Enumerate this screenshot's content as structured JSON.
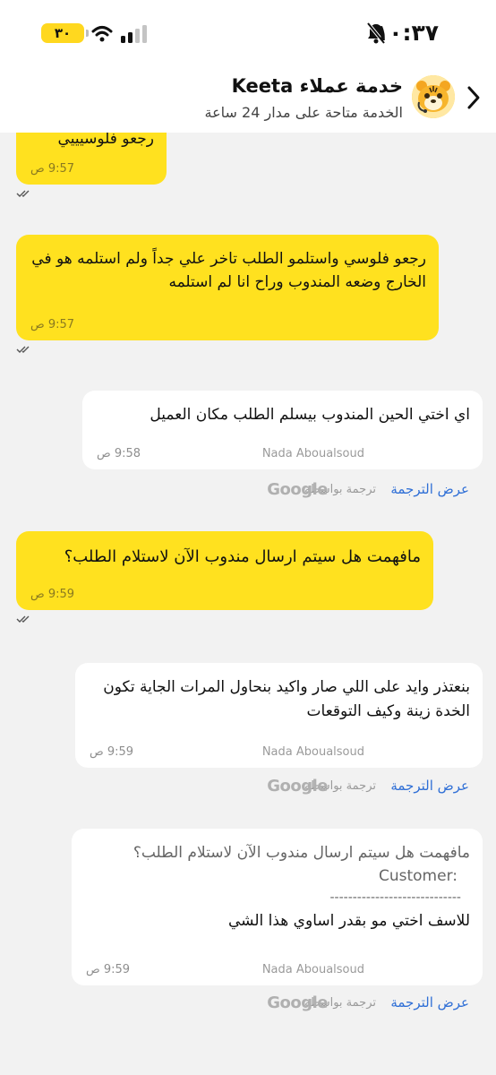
{
  "status_bar": {
    "time": "١٠:٣٧",
    "battery": "٣٠",
    "accent": "#ffd81f"
  },
  "header": {
    "title": "خدمة عملاء Keeta",
    "subtitle": "الخدمة متاحة على مدار 24 ساعة",
    "back_icon": "chevron-right-icon",
    "avatar_icon": "tiger-mascot-icon"
  },
  "messages": [
    {
      "from": "customer",
      "text": "رجعو فلوسيييي",
      "time": "9:57 ص",
      "ticks": "read"
    },
    {
      "from": "customer",
      "text": "رجعو فلوسي واستلمو الطلب تاخر علي جداً ولم استلمه هو في الخارج وضعه المندوب وراح انا لم استلمه",
      "time": "9:57 ص",
      "ticks": "read"
    },
    {
      "from": "agent",
      "text": "اي اختي الحين المندوب بيسلم الطلب مكان العميل",
      "time": "9:58 ص",
      "sender": "Nada Aboualsoud"
    },
    {
      "from": "customer",
      "text": "مافهمت هل سيتم ارسال مندوب الآن لاستلام الطلب؟",
      "time": "9:59 ص",
      "ticks": "read"
    },
    {
      "from": "agent",
      "text": "بنعتذر وايد على اللي صار واكيد بنحاول المرات الجاية تكون الخدة زينة وكيف التوقعات",
      "time": "9:59 ص",
      "sender": "Nada Aboualsoud"
    },
    {
      "from": "agent",
      "quote_label": "Customer:",
      "quote": "مافهمت هل سيتم ارسال مندوب الآن لاستلام الطلب؟",
      "divider": "-----------------------------",
      "text": "للاسف اختي مو بقدر اساوي هذا الشي",
      "time": "9:59 ص",
      "sender": "Nada Aboualsoud"
    }
  ],
  "translation": {
    "show_label": "عرض الترجمة",
    "by_label": "ترجمة بواسطة",
    "brand": "Google"
  },
  "colors": {
    "customer_bubble": "#ffe11f",
    "agent_bubble": "#ffffff",
    "link": "#2f6fd6"
  }
}
